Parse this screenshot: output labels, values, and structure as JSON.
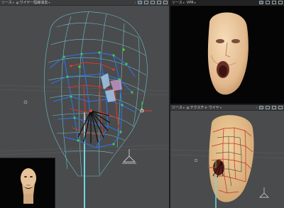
{
  "main_view": {
    "view_label": "ソース",
    "mode_label": "ワイヤー陰線消去",
    "icons": [
      "dots-icon",
      "camera-icon",
      "view-icon",
      "settings-icon",
      "square-icon",
      "maximize-icon"
    ]
  },
  "render_view": {
    "view_label": "ソース",
    "mode_label": "VPR",
    "icons": [
      "camera-icon",
      "settings-icon",
      "square-icon",
      "maximize-icon"
    ]
  },
  "texture_view": {
    "view_label": "ソース",
    "mode_label": "テクスチャ ワイヤ",
    "icons": [
      "dots-icon",
      "camera-icon",
      "settings-icon",
      "square-icon",
      "maximize-icon"
    ]
  },
  "colors": {
    "viewport_bg": "#4a4b4d",
    "render_bg": "#050505",
    "wire_cyan": "#6fd7e0",
    "cage_blue": "#2f6fd8",
    "cage_red": "#d23a2a",
    "vertex_green": "#3fcf4a",
    "skin": "#e6c39a"
  }
}
